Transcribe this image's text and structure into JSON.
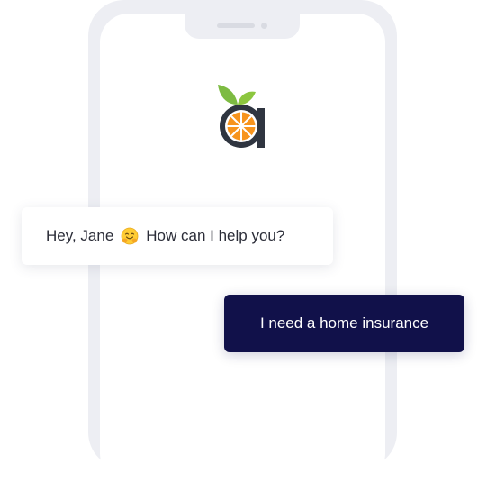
{
  "chat": {
    "bot_greeting": "Hey, Jane",
    "bot_emoji": "hugging-face-emoji",
    "bot_question": "How can I help you?",
    "user_message": "I need a home insurance"
  },
  "colors": {
    "user_bubble": "#11114a",
    "logo_orange": "#f7941d",
    "logo_leaf": "#7dbb42",
    "logo_dark": "#2f3540",
    "phone_frame": "#edeef3"
  },
  "icons": {
    "logo": "orange-slice-a-logo"
  }
}
